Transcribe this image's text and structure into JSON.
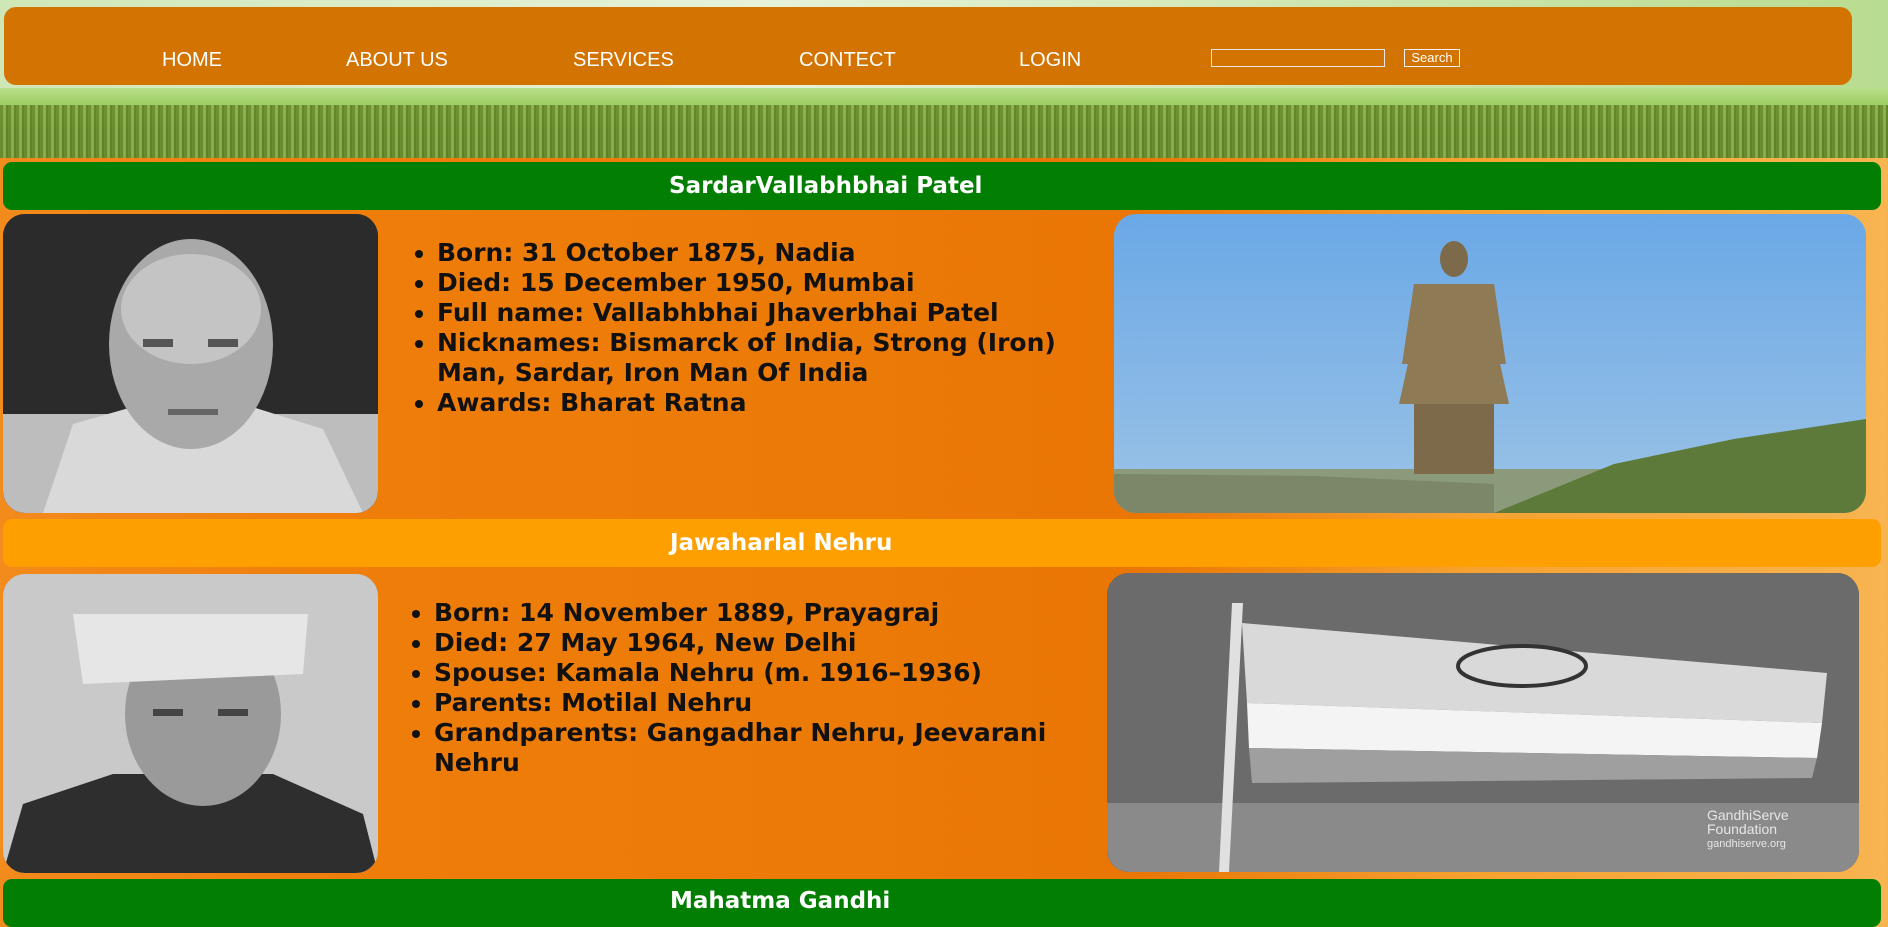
{
  "nav": {
    "items": [
      "HOME",
      "ABOUT US",
      "SERVICES",
      "CONTECT",
      "LOGIN"
    ],
    "search_placeholder": "",
    "search_label": "Search"
  },
  "sections": [
    {
      "title": "SardarVallabhbhai Patel",
      "facts": [
        "Born: 31 October 1875, Nadia",
        "Died: 15 December 1950, Mumbai",
        "Full name: Vallabhbhai Jhaverbhai Patel",
        "Nicknames: Bismarck of India, Strong (Iron) Man, Sardar, Iron Man Of India",
        "Awards: Bharat Ratna"
      ]
    },
    {
      "title": "Jawaharlal Nehru",
      "facts": [
        "Born: 14 November 1889, Prayagraj",
        "Died: 27 May 1964, New Delhi",
        "Spouse: Kamala Nehru (m. 1916–1936)",
        "Parents: Motilal Nehru",
        "Grandparents: Gangadhar Nehru, Jeevarani Nehru"
      ],
      "photo_caption": [
        "GandhiServe",
        "Foundation",
        "gandhiserve.org"
      ]
    },
    {
      "title": "Mahatma Gandhi"
    }
  ],
  "colors": {
    "nav_bg": "#d37402",
    "green_bar": "#027f02",
    "orange_bar": "#fe9f00"
  }
}
